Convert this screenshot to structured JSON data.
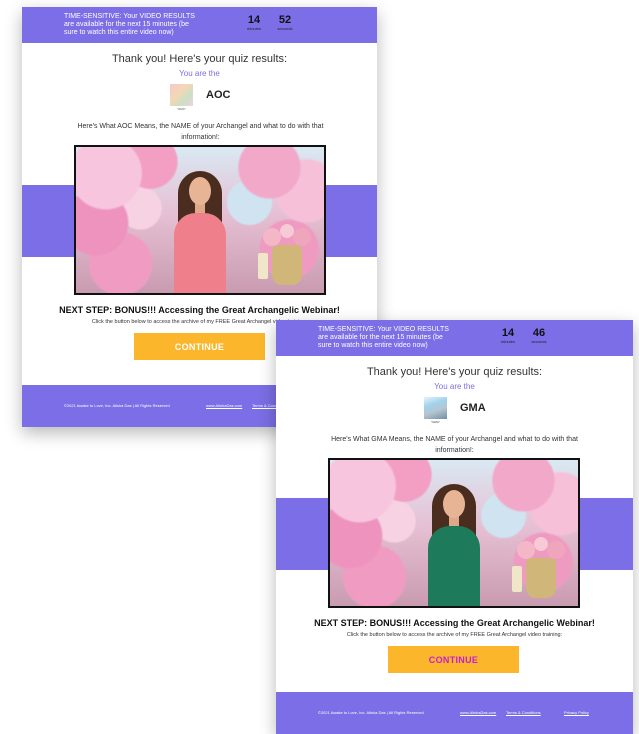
{
  "back_card": {
    "notice": "TIME-SENSITIVE: Your VIDEO RESULTS are available for the next 15 minutes (be sure to watch this entire video now)",
    "timer_minutes": "14",
    "timer_minutes_label": "minutes",
    "timer_seconds": "52",
    "timer_seconds_label": "seconds",
    "thanks": "Thank you! Here's your quiz results:",
    "you_are": "You are the",
    "thumb_caption": "\"AOC\"",
    "code": "AOC",
    "means": "Here's What AOC Means, the NAME of your Archangel and what to do with that information!:",
    "next_step": "NEXT STEP: BONUS!!! Accessing the Great Archangelic Webinar!",
    "click_text": "Click the button below to access the archive of my FREE Great Archangel video training:",
    "continue": "CONTINUE",
    "footer_copy": "©2021 Awake to Love, Inc. Alisha Das | All Rights Reserved",
    "footer_link_site": "www.AlishaDas.com",
    "footer_link_terms": "Terms & Conditions"
  },
  "front_card": {
    "notice": "TIME-SENSITIVE: Your VIDEO RESULTS are available for the next 15 minutes (be sure to watch this entire video now)",
    "timer_minutes": "14",
    "timer_minutes_label": "minutes",
    "timer_seconds": "46",
    "timer_seconds_label": "seconds",
    "thanks": "Thank you! Here's your quiz results:",
    "you_are": "You are the",
    "thumb_caption": "\"GMA\"",
    "code": "GMA",
    "means": "Here's What GMA Means, the NAME of your Archangel and what to do with that information!:",
    "next_step": "NEXT STEP: BONUS!!! Accessing the Great Archangelic Webinar!",
    "click_text": "Click the button below to access the archive of my FREE Great Archangel video training:",
    "continue": "CONTINUE",
    "footer_copy": "©2021 Awake to Love, Inc. Alisha Das | All Rights Reserved",
    "footer_link_site": "www.AlishaDas.com",
    "footer_link_terms": "Terms & Conditions",
    "footer_link_privacy": "Privacy Policy"
  },
  "colors": {
    "brand_purple": "#7b6ee6",
    "button_orange": "#fbb62b",
    "button_text_magenta": "#c51fd2"
  },
  "icons": {
    "result_thumbnail": "angel-image-thumbnail",
    "video": "video-player"
  }
}
